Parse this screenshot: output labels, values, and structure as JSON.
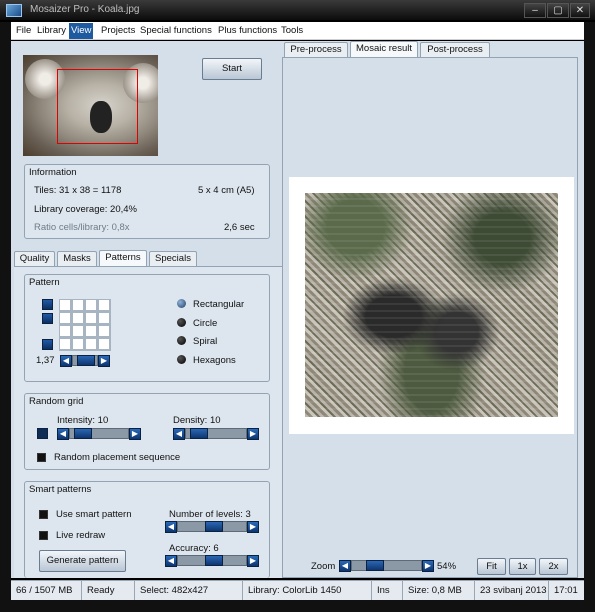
{
  "window": {
    "title": "Mosaizer Pro - Koala.jpg"
  },
  "menu": [
    "File",
    "Library",
    "View",
    "Projects",
    "Special functions",
    "Plus functions",
    "Tools"
  ],
  "menu_active": "View",
  "start_button": "Start",
  "information": {
    "label": "Information",
    "tiles": "Tiles: 31 x 38 = 1178",
    "size": "5 x 4 cm  (A5)",
    "coverage": "Library coverage: 20,4%",
    "ratio": "Ratio cells/library: 0,8x",
    "time": "2,6 sec"
  },
  "left_tabs": [
    "Quality",
    "Masks",
    "Patterns",
    "Specials"
  ],
  "left_tab_selected": "Patterns",
  "pattern": {
    "label": "Pattern",
    "value": "1,37",
    "options": [
      "Rectangular",
      "Circle",
      "Spiral",
      "Hexagons"
    ],
    "selected": "Rectangular"
  },
  "random_grid": {
    "label": "Random grid",
    "intensity": "Intensity: 10",
    "density": "Density: 10",
    "placement": "Random placement sequence",
    "intensity_level": 0.1,
    "density_level": 0.1
  },
  "smart_patterns": {
    "label": "Smart patterns",
    "use": "Use smart pattern",
    "live": "Live redraw",
    "levels": "Number of levels: 3",
    "accuracy": "Accuracy: 6",
    "generate": "Generate pattern",
    "levels_level": 0.5,
    "accuracy_level": 0.5
  },
  "right_tabs": [
    "Pre-process",
    "Mosaic result",
    "Post-process"
  ],
  "right_tab_selected": "Mosaic result",
  "zoom": {
    "label": "Zoom",
    "value": "54%",
    "level": 0.2
  },
  "view_buttons": [
    "Fit",
    "1x",
    "2x"
  ],
  "status": {
    "memory": "66 / 1507 MB",
    "state": "Ready",
    "select": "Select: 482x427",
    "library": "Library: ColorLib 1450",
    "ins": "Ins",
    "size": "Size: 0,8 MB",
    "date": "23 svibanj 2013",
    "time": "17:01"
  },
  "colors": {
    "accent": "#1e5aa0",
    "panel": "#d5dfe9",
    "frame": "#111111"
  }
}
